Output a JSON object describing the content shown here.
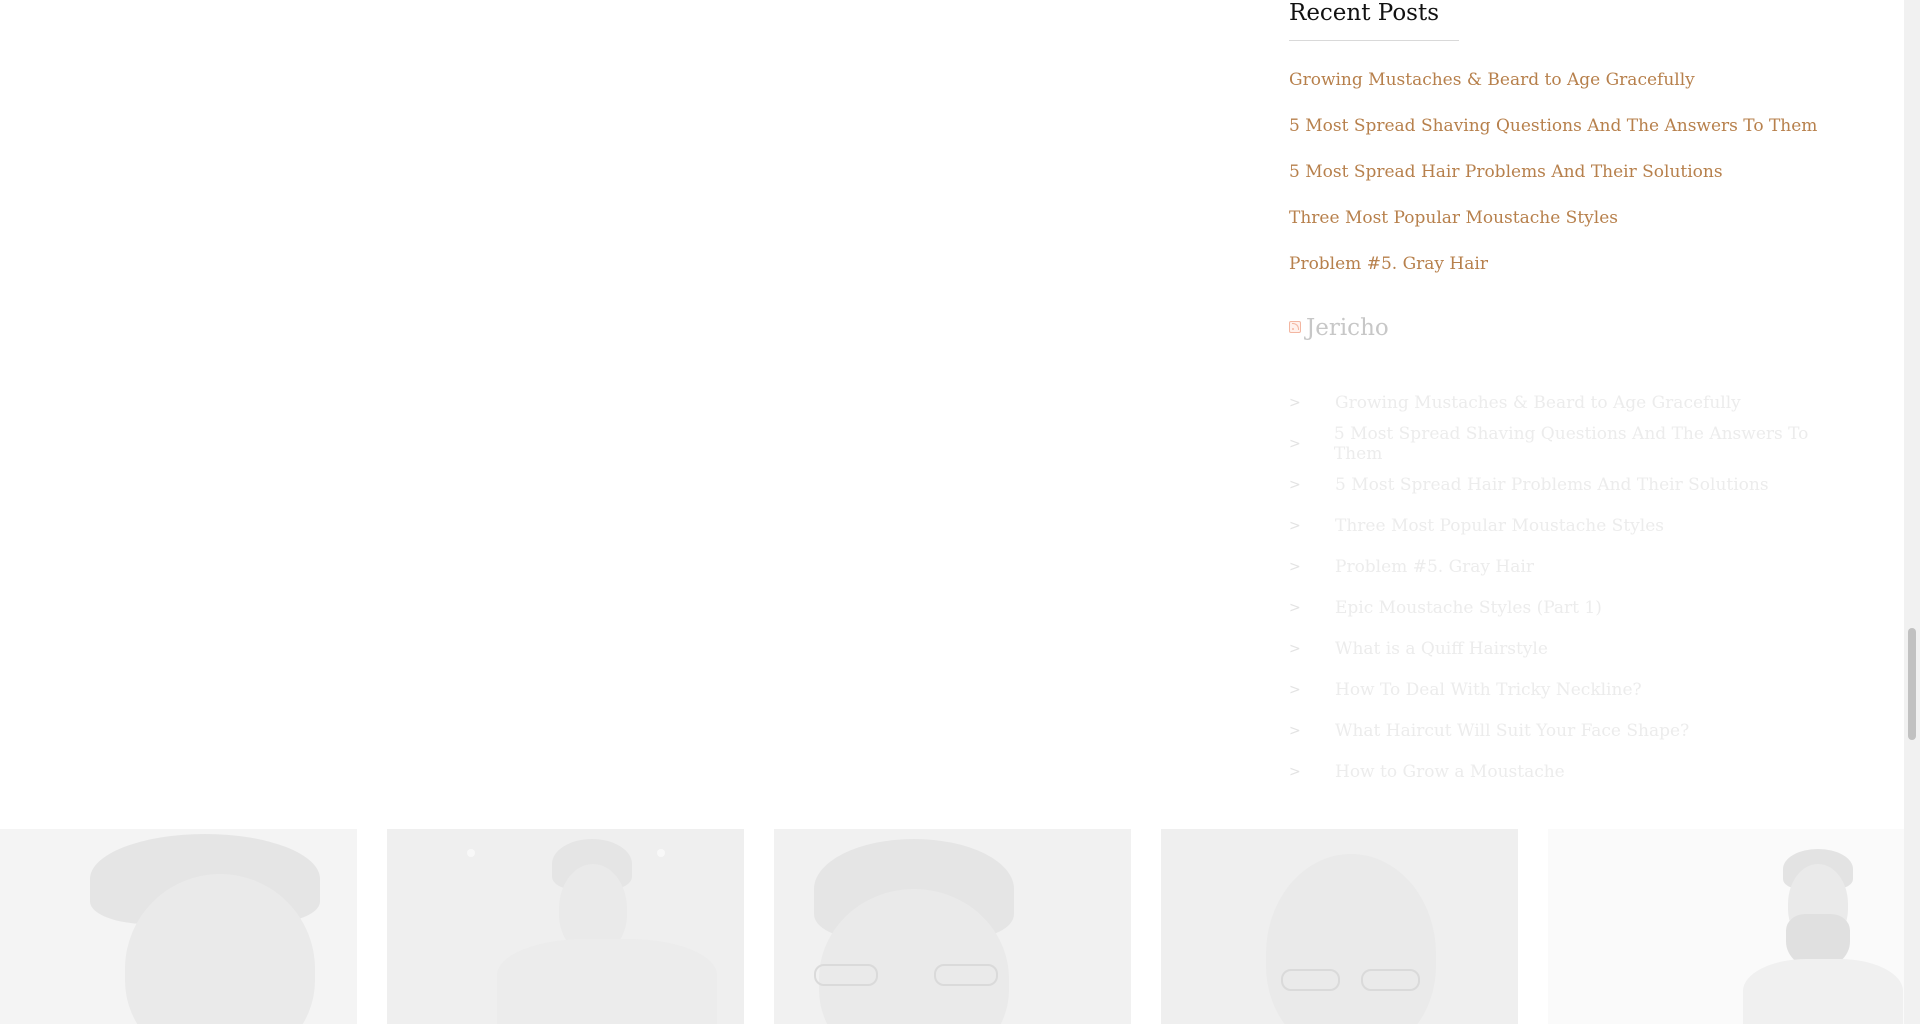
{
  "recent_posts": {
    "title": "Recent Posts",
    "items": [
      "Growing Mustaches & Beard to Age Gracefully",
      "5 Most Spread Shaving Questions And The Answers To Them",
      "5 Most Spread Hair Problems And Their Solutions",
      "Three Most Popular Moustache Styles",
      "Problem #5. Gray Hair"
    ]
  },
  "rss": {
    "title": "Jericho",
    "chevron": ">",
    "items": [
      "Growing Mustaches & Beard to Age Gracefully",
      "5 Most Spread Shaving Questions And The Answers To Them",
      "5 Most Spread Hair Problems And Their Solutions",
      "Three Most Popular Moustache Styles",
      "Problem #5. Gray Hair",
      "Epic Moustache Styles (Part 1)",
      "What is a Quiff Hairstyle",
      "How To Deal With Tricky Neckline?",
      "What Haircut Will Suit Your Face Shape?",
      "How to Grow a Moustache"
    ]
  },
  "colors": {
    "link": "#b7804c",
    "faded_link": "#ececec",
    "title": "#111111"
  },
  "gallery_icons": [
    "man-hair-photo",
    "young-man-cap-photo",
    "man-glasses-photo",
    "older-man-glasses-photo",
    "bearded-man-photo"
  ]
}
